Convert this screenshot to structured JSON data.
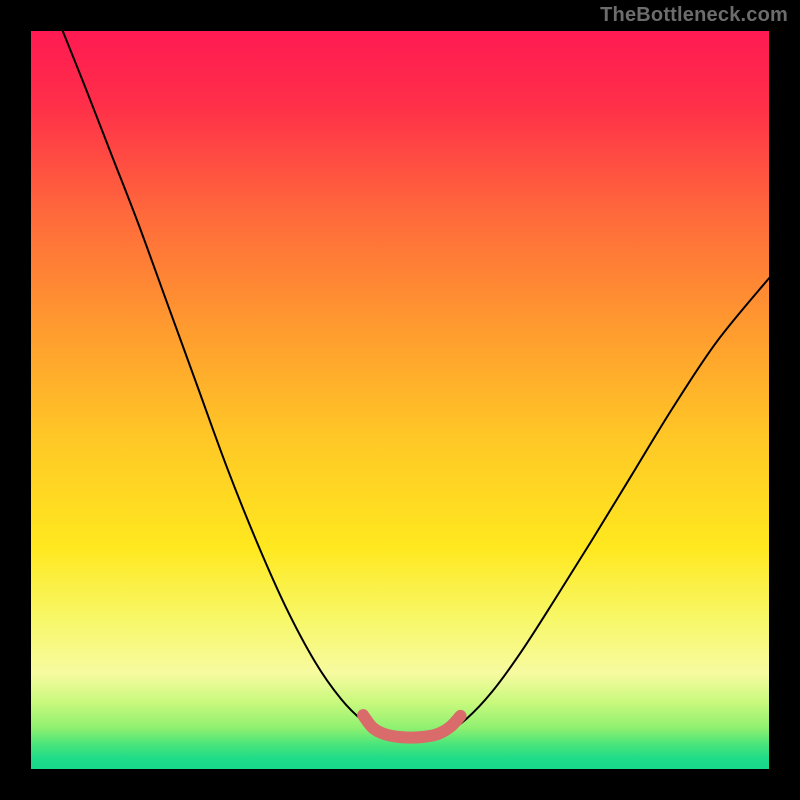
{
  "watermark": "TheBottleneck.com",
  "chart_data": {
    "type": "line",
    "title": "",
    "xlabel": "",
    "ylabel": "",
    "background": {
      "kind": "vertical-gradient",
      "description": "Rainbow gradient from red (top) through orange/yellow to green (bottom), with a thin bright green band at the very bottom edge",
      "stops": [
        {
          "offset": 0.0,
          "color": "#ff1a52"
        },
        {
          "offset": 0.1,
          "color": "#ff2f49"
        },
        {
          "offset": 0.25,
          "color": "#ff6a3b"
        },
        {
          "offset": 0.4,
          "color": "#ff9a2f"
        },
        {
          "offset": 0.55,
          "color": "#ffc726"
        },
        {
          "offset": 0.7,
          "color": "#ffe81f"
        },
        {
          "offset": 0.8,
          "color": "#f7f86a"
        },
        {
          "offset": 0.87,
          "color": "#f7faa0"
        },
        {
          "offset": 0.91,
          "color": "#c8f97d"
        },
        {
          "offset": 0.945,
          "color": "#8ef070"
        },
        {
          "offset": 0.965,
          "color": "#4de67a"
        },
        {
          "offset": 0.985,
          "color": "#20dc88"
        },
        {
          "offset": 1.0,
          "color": "#16d88b"
        }
      ]
    },
    "series": [
      {
        "name": "bottleneck-curve",
        "description": "V-shaped curve: steep descent from upper-left, shallow base around x≈0.47–0.58, then rises toward right edge",
        "points_normalized": [
          {
            "x": 0.043,
            "y": 0.0
          },
          {
            "x": 0.075,
            "y": 0.08
          },
          {
            "x": 0.11,
            "y": 0.17
          },
          {
            "x": 0.145,
            "y": 0.26
          },
          {
            "x": 0.185,
            "y": 0.37
          },
          {
            "x": 0.225,
            "y": 0.48
          },
          {
            "x": 0.265,
            "y": 0.59
          },
          {
            "x": 0.305,
            "y": 0.69
          },
          {
            "x": 0.345,
            "y": 0.78
          },
          {
            "x": 0.385,
            "y": 0.855
          },
          {
            "x": 0.42,
            "y": 0.905
          },
          {
            "x": 0.45,
            "y": 0.935
          },
          {
            "x": 0.478,
            "y": 0.952
          },
          {
            "x": 0.505,
            "y": 0.958
          },
          {
            "x": 0.532,
            "y": 0.958
          },
          {
            "x": 0.56,
            "y": 0.952
          },
          {
            "x": 0.59,
            "y": 0.932
          },
          {
            "x": 0.625,
            "y": 0.895
          },
          {
            "x": 0.665,
            "y": 0.84
          },
          {
            "x": 0.71,
            "y": 0.77
          },
          {
            "x": 0.76,
            "y": 0.69
          },
          {
            "x": 0.815,
            "y": 0.6
          },
          {
            "x": 0.87,
            "y": 0.51
          },
          {
            "x": 0.93,
            "y": 0.42
          },
          {
            "x": 1.0,
            "y": 0.335
          }
        ]
      }
    ],
    "highlight": {
      "name": "optimal-range-marker",
      "color": "#d96b6b",
      "description": "Thick salmon segment tracing the base of the V between x≈0.45 and x≈0.58",
      "points_normalized": [
        {
          "x": 0.45,
          "y": 0.927
        },
        {
          "x": 0.463,
          "y": 0.944
        },
        {
          "x": 0.48,
          "y": 0.953
        },
        {
          "x": 0.503,
          "y": 0.957
        },
        {
          "x": 0.527,
          "y": 0.957
        },
        {
          "x": 0.55,
          "y": 0.953
        },
        {
          "x": 0.568,
          "y": 0.943
        },
        {
          "x": 0.582,
          "y": 0.928
        }
      ]
    },
    "xlim": [
      0,
      1
    ],
    "ylim": [
      0,
      1
    ]
  }
}
